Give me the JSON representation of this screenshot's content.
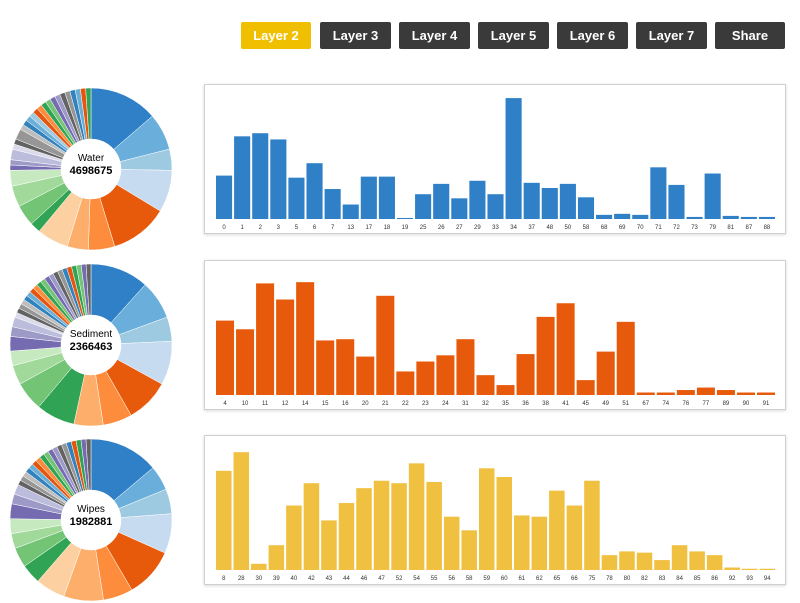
{
  "toolbar": {
    "buttons": [
      {
        "label": "Layer 2",
        "active": true
      },
      {
        "label": "Layer 3",
        "active": false
      },
      {
        "label": "Layer 4",
        "active": false
      },
      {
        "label": "Layer 5",
        "active": false
      },
      {
        "label": "Layer 6",
        "active": false
      },
      {
        "label": "Layer 7",
        "active": false
      },
      {
        "label": "Share",
        "active": false
      }
    ]
  },
  "colors": {
    "water": "#2f80c6",
    "sediment": "#e85a0b",
    "wipes": "#f0c040",
    "active_button": "#f0c000",
    "button": "#3a3a3a"
  },
  "chart_data": [
    {
      "type": "pie",
      "name": "Water",
      "total": "4698675",
      "values": [
        13,
        7,
        4,
        8,
        11,
        5,
        4,
        6,
        2,
        4,
        4,
        3,
        1,
        1,
        2,
        1,
        1,
        2,
        1,
        1,
        1,
        1,
        1,
        1,
        1,
        1,
        1,
        1,
        1,
        1,
        1,
        1,
        1,
        1
      ],
      "colors": [
        "#2f80c6",
        "#6aaedb",
        "#9ecae1",
        "#c6dbef",
        "#e85a0b",
        "#fd8d3c",
        "#fdae6b",
        "#fdd0a2",
        "#31a354",
        "#74c476",
        "#a1d99b",
        "#c7e9c0",
        "#756bb1",
        "#9e9ac8",
        "#bcbddc",
        "#dadaeb",
        "#636363",
        "#969696",
        "#bdbdbd",
        "#3182bd",
        "#6baed6",
        "#9ecae1",
        "#e6550d",
        "#fd8d3c",
        "#31a354",
        "#74c476",
        "#756bb1",
        "#9e9ac8",
        "#636363",
        "#969696",
        "#3182bd",
        "#6baed6",
        "#e6550d",
        "#31a354"
      ]
    },
    {
      "type": "bar",
      "name": "Water",
      "color": "#2f80c6",
      "categories": [
        "0",
        "1",
        "2",
        "3",
        "5",
        "6",
        "7",
        "13",
        "17",
        "18",
        "19",
        "25",
        "26",
        "27",
        "29",
        "33",
        "34",
        "37",
        "48",
        "50",
        "58",
        "68",
        "69",
        "70",
        "71",
        "72",
        "73",
        "79",
        "81",
        "87",
        "88"
      ],
      "values": [
        42,
        80,
        83,
        77,
        40,
        54,
        29,
        14,
        41,
        41,
        1,
        24,
        34,
        20,
        37,
        24,
        117,
        35,
        30,
        34,
        21,
        4,
        5,
        4,
        50,
        33,
        2,
        44,
        3,
        2,
        2
      ],
      "ylim": [
        0,
        120
      ]
    },
    {
      "type": "pie",
      "name": "Sediment",
      "total": "2366463",
      "values": [
        12,
        8,
        5,
        9,
        9,
        6,
        6,
        8,
        6,
        4,
        3,
        3,
        2,
        2,
        1,
        1,
        1,
        1,
        1,
        1,
        1,
        1,
        1,
        1,
        1,
        1,
        1,
        1,
        1,
        1,
        1,
        1,
        1,
        1
      ],
      "colors": [
        "#2f80c6",
        "#6aaedb",
        "#9ecae1",
        "#c6dbef",
        "#e85a0b",
        "#fd8d3c",
        "#fdae6b",
        "#31a354",
        "#74c476",
        "#a1d99b",
        "#c7e9c0",
        "#756bb1",
        "#9e9ac8",
        "#bcbddc",
        "#dadaeb",
        "#636363",
        "#969696",
        "#bdbdbd",
        "#3182bd",
        "#6baed6",
        "#e6550d",
        "#fd8d3c",
        "#31a354",
        "#74c476",
        "#756bb1",
        "#9e9ac8",
        "#636363",
        "#969696",
        "#3182bd",
        "#e6550d",
        "#31a354",
        "#74c476",
        "#756bb1",
        "#636363"
      ]
    },
    {
      "type": "bar",
      "name": "Sediment",
      "color": "#e85a0b",
      "categories": [
        "4",
        "10",
        "11",
        "12",
        "14",
        "15",
        "16",
        "20",
        "21",
        "22",
        "23",
        "24",
        "31",
        "32",
        "35",
        "36",
        "38",
        "41",
        "45",
        "49",
        "51",
        "67",
        "74",
        "76",
        "77",
        "89",
        "90",
        "91"
      ],
      "values": [
        60,
        53,
        90,
        77,
        91,
        44,
        45,
        31,
        80,
        19,
        27,
        32,
        45,
        16,
        8,
        33,
        63,
        74,
        12,
        35,
        59,
        2,
        2,
        4,
        6,
        4,
        2,
        2
      ],
      "ylim": [
        0,
        100
      ]
    },
    {
      "type": "pie",
      "name": "Wipes",
      "total": "1982881",
      "values": [
        14,
        5,
        5,
        8,
        10,
        6,
        8,
        6,
        4,
        4,
        3,
        3,
        3,
        2,
        2,
        1,
        1,
        1,
        1,
        1,
        1,
        1,
        1,
        1,
        1,
        1,
        1,
        1,
        1,
        1,
        1,
        1,
        1
      ],
      "colors": [
        "#2f80c6",
        "#6aaedb",
        "#9ecae1",
        "#c6dbef",
        "#e85a0b",
        "#fd8d3c",
        "#fdae6b",
        "#fdd0a2",
        "#31a354",
        "#74c476",
        "#a1d99b",
        "#c7e9c0",
        "#756bb1",
        "#9e9ac8",
        "#bcbddc",
        "#636363",
        "#969696",
        "#bdbdbd",
        "#3182bd",
        "#6baed6",
        "#e6550d",
        "#fd8d3c",
        "#31a354",
        "#74c476",
        "#756bb1",
        "#9e9ac8",
        "#636363",
        "#969696",
        "#3182bd",
        "#e6550d",
        "#31a354",
        "#756bb1",
        "#636363"
      ]
    },
    {
      "type": "bar",
      "name": "Wipes",
      "color": "#f0c040",
      "categories": [
        "8",
        "28",
        "30",
        "39",
        "40",
        "42",
        "43",
        "44",
        "46",
        "47",
        "52",
        "54",
        "55",
        "56",
        "58",
        "59",
        "60",
        "61",
        "62",
        "65",
        "66",
        "75",
        "78",
        "80",
        "82",
        "83",
        "84",
        "85",
        "86",
        "92",
        "93",
        "94"
      ],
      "values": [
        80,
        95,
        5,
        20,
        52,
        70,
        40,
        54,
        66,
        72,
        70,
        86,
        71,
        43,
        32,
        82,
        75,
        44,
        43,
        64,
        52,
        72,
        12,
        15,
        14,
        8,
        20,
        15,
        12,
        2,
        1,
        1
      ],
      "ylim": [
        0,
        100
      ]
    }
  ]
}
